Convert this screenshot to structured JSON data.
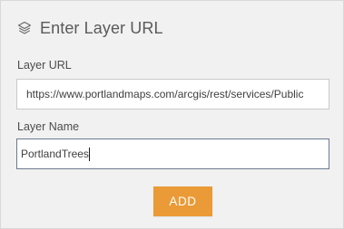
{
  "panel": {
    "title": "Enter Layer URL",
    "title_icon": "layers-icon"
  },
  "form": {
    "url_label": "Layer URL",
    "url_value": "https://www.portlandmaps.com/arcgis/rest/services/Public",
    "name_label": "Layer Name",
    "name_value": "PortlandTrees"
  },
  "actions": {
    "add_label": "ADD"
  },
  "colors": {
    "panel_background": "#f1f1f1",
    "add_button": "#ea9a36",
    "title_text": "#5a5a5a",
    "focused_border": "#6c7a8e"
  }
}
